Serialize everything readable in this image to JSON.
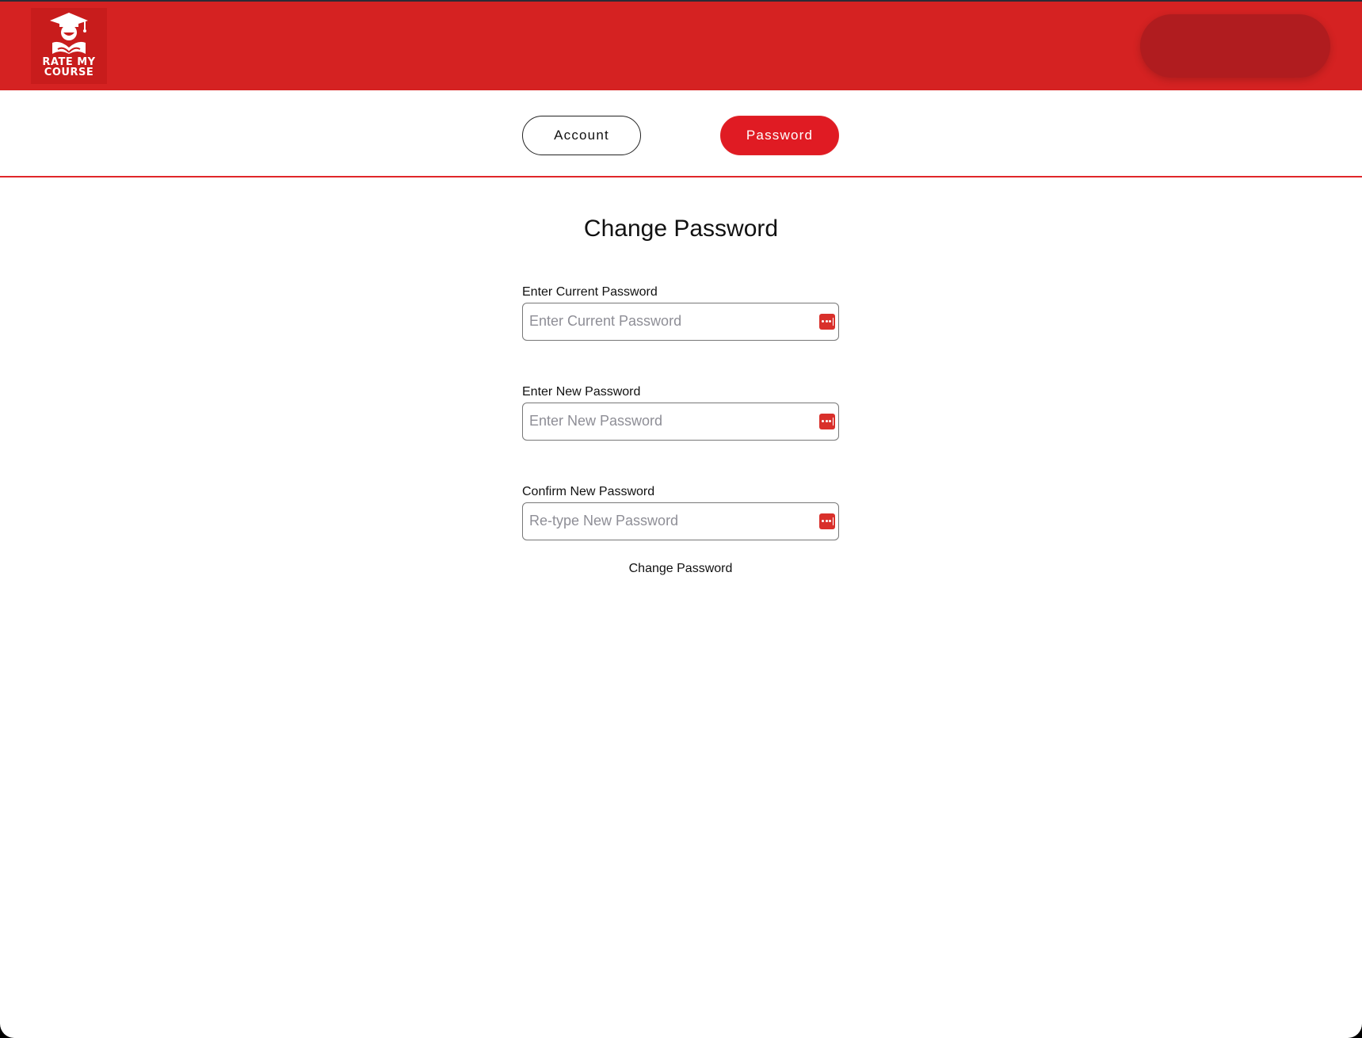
{
  "brand": {
    "logo_line1": "RATE MY",
    "logo_line2": "COURSE",
    "primary_color": "#d52222",
    "accent_color": "#e01b23"
  },
  "tabs": [
    {
      "label": "Account",
      "active": false
    },
    {
      "label": "Password",
      "active": true
    }
  ],
  "form": {
    "title": "Change Password",
    "fields": [
      {
        "label": "Enter Current Password",
        "placeholder": "Enter Current Password",
        "value": ""
      },
      {
        "label": "Enter New Password",
        "placeholder": "Enter New Password",
        "value": ""
      },
      {
        "label": "Confirm New Password",
        "placeholder": "Re-type New Password",
        "value": ""
      }
    ],
    "submit_label": "Change Password"
  },
  "icons": {
    "password_manager": "password-key-icon",
    "logo_mascot": "graduate-mascot-icon"
  }
}
